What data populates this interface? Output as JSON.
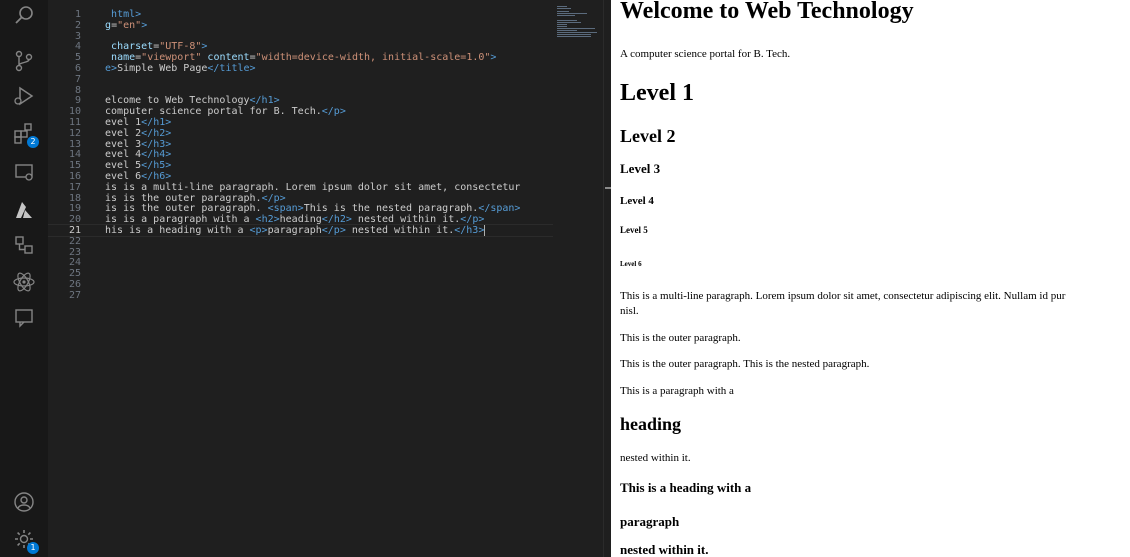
{
  "activity_bar": {
    "extensions_badge": "2",
    "settings_badge": "1"
  },
  "editor": {
    "lines": [
      {
        "n": "1",
        "html": "  <span class=\"tag\">html&gt;</span>"
      },
      {
        "n": "2",
        "html": " <span class=\"attr\">g</span>=<span class=\"str\">\"en\"</span><span class=\"tag\">&gt;</span>"
      },
      {
        "n": "3",
        "html": ""
      },
      {
        "n": "4",
        "html": "  <span class=\"attr\">charset</span>=<span class=\"str\">\"UTF-8\"</span><span class=\"tag\">&gt;</span>"
      },
      {
        "n": "5",
        "html": "  <span class=\"attr\">name</span>=<span class=\"str\">\"viewport\"</span> <span class=\"attr\">content</span>=<span class=\"str\">\"width=device-width, initial-scale=1.0\"</span><span class=\"tag\">&gt;</span>"
      },
      {
        "n": "6",
        "html": " <span class=\"tag\">e&gt;</span>Simple Web Page<span class=\"tag\">&lt;/title&gt;</span>"
      },
      {
        "n": "7",
        "html": ""
      },
      {
        "n": "8",
        "html": ""
      },
      {
        "n": "9",
        "html": " elcome to Web Technology<span class=\"tag\">&lt;/h1&gt;</span>"
      },
      {
        "n": "10",
        "html": " computer science portal for B. Tech.<span class=\"tag\">&lt;/p&gt;</span>"
      },
      {
        "n": "11",
        "html": " evel 1<span class=\"tag\">&lt;/h1&gt;</span>"
      },
      {
        "n": "12",
        "html": " evel 2<span class=\"tag\">&lt;/h2&gt;</span>"
      },
      {
        "n": "13",
        "html": " evel 3<span class=\"tag\">&lt;/h3&gt;</span>"
      },
      {
        "n": "14",
        "html": " evel 4<span class=\"tag\">&lt;/h4&gt;</span>"
      },
      {
        "n": "15",
        "html": " evel 5<span class=\"tag\">&lt;/h5&gt;</span>"
      },
      {
        "n": "16",
        "html": " evel 6<span class=\"tag\">&lt;/h6&gt;</span>"
      },
      {
        "n": "17",
        "html": " is is a multi-line paragraph. Lorem ipsum dolor sit amet, consectetur"
      },
      {
        "n": "18",
        "html": " is is the outer paragraph.<span class=\"tag\">&lt;/p&gt;</span>"
      },
      {
        "n": "19",
        "html": " is is the outer paragraph. <span class=\"tag\">&lt;span&gt;</span>This is the nested paragraph.<span class=\"tag\">&lt;/span&gt;</span>"
      },
      {
        "n": "20",
        "html": " is is a paragraph with a <span class=\"tag\">&lt;h2&gt;</span>heading<span class=\"tag\">&lt;/h2&gt;</span> nested within it.<span class=\"tag\">&lt;/p&gt;</span>"
      },
      {
        "n": "21",
        "html": " his is a heading with a <span class=\"tag\">&lt;p&gt;</span>paragraph<span class=\"tag\">&lt;/p&gt;</span> nested within it.<span class=\"tag\">&lt;/h3&gt;</span>"
      },
      {
        "n": "22",
        "html": ""
      },
      {
        "n": "23",
        "html": ""
      },
      {
        "n": "24",
        "html": ""
      },
      {
        "n": "25",
        "html": ""
      },
      {
        "n": "26",
        "html": ""
      },
      {
        "n": "27",
        "html": ""
      }
    ],
    "current_line": "21"
  },
  "preview": {
    "items": [
      {
        "cls": "pv-h1",
        "text": "Welcome to Web Technology"
      },
      {
        "cls": "pv-p",
        "text": "A computer science portal for B. Tech."
      },
      {
        "cls": "pv-h1",
        "text": "Level 1"
      },
      {
        "cls": "pv-h2",
        "text": "Level 2"
      },
      {
        "cls": "pv-h3",
        "text": "Level 3"
      },
      {
        "cls": "pv-h4",
        "text": "Level 4"
      },
      {
        "cls": "pv-h5",
        "text": "Level 5"
      },
      {
        "cls": "pv-h6",
        "text": "Level 6"
      },
      {
        "cls": "pv-p",
        "text": "This is a multi-line paragraph. Lorem ipsum dolor sit amet, consectetur adipiscing elit. Nullam id pur"
      },
      {
        "cls": "pv-p",
        "text": "nisl."
      },
      {
        "cls": "pv-p",
        "text": "This is the outer paragraph."
      },
      {
        "cls": "pv-p",
        "text": "This is the outer paragraph. This is the nested paragraph."
      },
      {
        "cls": "pv-p",
        "text": "This is a paragraph with a"
      },
      {
        "cls": "pv-h2",
        "text": "heading"
      },
      {
        "cls": "pv-p",
        "text": "nested within it."
      },
      {
        "cls": "pv-h3",
        "text": "This is a heading with a"
      },
      {
        "cls": "pv-h3",
        "text": "paragraph"
      },
      {
        "cls": "pv-h3",
        "text": "nested within it."
      }
    ]
  }
}
